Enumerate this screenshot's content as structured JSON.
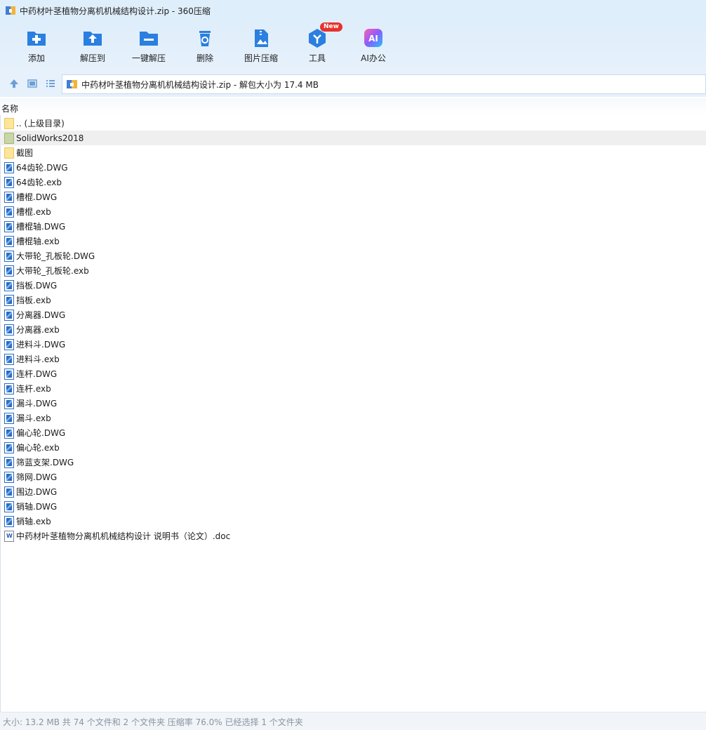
{
  "window": {
    "title": "中药材叶茎植物分离机机械结构设计.zip - 360压缩"
  },
  "toolbar": {
    "items": [
      {
        "label": "添加",
        "icon": "add-icon",
        "color": "#2a7fe0"
      },
      {
        "label": "解压到",
        "icon": "extract-to-icon",
        "color": "#2a7fe0"
      },
      {
        "label": "一键解压",
        "icon": "one-click-extract-icon",
        "color": "#2a7fe0"
      },
      {
        "label": "删除",
        "icon": "recycle-delete-icon",
        "color": "#2a7fe0"
      },
      {
        "label": "图片压缩",
        "icon": "image-compress-icon",
        "color": "#2a7fe0"
      },
      {
        "label": "工具",
        "icon": "tools-icon",
        "color": "#2a7fe0",
        "badge": "New"
      },
      {
        "label": "AI办公",
        "icon": "ai-office-icon",
        "color": "#6a5cff"
      }
    ]
  },
  "address": {
    "path": "中药材叶茎植物分离机机械结构设计.zip - 解包大小为 17.4 MB"
  },
  "columns": {
    "name": "名称"
  },
  "files": [
    {
      "name": ".. (上级目录)",
      "type": "folder"
    },
    {
      "name": "SolidWorks2018",
      "type": "folder",
      "selected": true
    },
    {
      "name": "截图",
      "type": "folder"
    },
    {
      "name": "64齿轮.DWG",
      "type": "dwg"
    },
    {
      "name": "64齿轮.exb",
      "type": "dwg"
    },
    {
      "name": "槽棍.DWG",
      "type": "dwg"
    },
    {
      "name": "槽棍.exb",
      "type": "dwg"
    },
    {
      "name": "槽棍轴.DWG",
      "type": "dwg"
    },
    {
      "name": "槽棍轴.exb",
      "type": "dwg"
    },
    {
      "name": "大带轮_孔板轮.DWG",
      "type": "dwg"
    },
    {
      "name": "大带轮_孔板轮.exb",
      "type": "dwg"
    },
    {
      "name": "挡板.DWG",
      "type": "dwg"
    },
    {
      "name": "挡板.exb",
      "type": "dwg"
    },
    {
      "name": "分离器.DWG",
      "type": "dwg"
    },
    {
      "name": "分离器.exb",
      "type": "dwg"
    },
    {
      "name": "进料斗.DWG",
      "type": "dwg"
    },
    {
      "name": "进料斗.exb",
      "type": "dwg"
    },
    {
      "name": "连杆.DWG",
      "type": "dwg"
    },
    {
      "name": "连杆.exb",
      "type": "dwg"
    },
    {
      "name": "漏斗.DWG",
      "type": "dwg"
    },
    {
      "name": "漏斗.exb",
      "type": "dwg"
    },
    {
      "name": "偏心轮.DWG",
      "type": "dwg"
    },
    {
      "name": "偏心轮.exb",
      "type": "dwg"
    },
    {
      "name": "筛蓝支架.DWG",
      "type": "dwg"
    },
    {
      "name": "筛网.DWG",
      "type": "dwg"
    },
    {
      "name": "围边.DWG",
      "type": "dwg"
    },
    {
      "name": "销轴.DWG",
      "type": "dwg"
    },
    {
      "name": "销轴.exb",
      "type": "dwg"
    },
    {
      "name": "中药材叶茎植物分离机机械结构设计 说明书（论文）.doc",
      "type": "doc"
    }
  ],
  "status": {
    "text": "大小: 13.2 MB 共 74 个文件和 2 个文件夹 压缩率 76.0% 已经选择 1 个文件夹"
  }
}
